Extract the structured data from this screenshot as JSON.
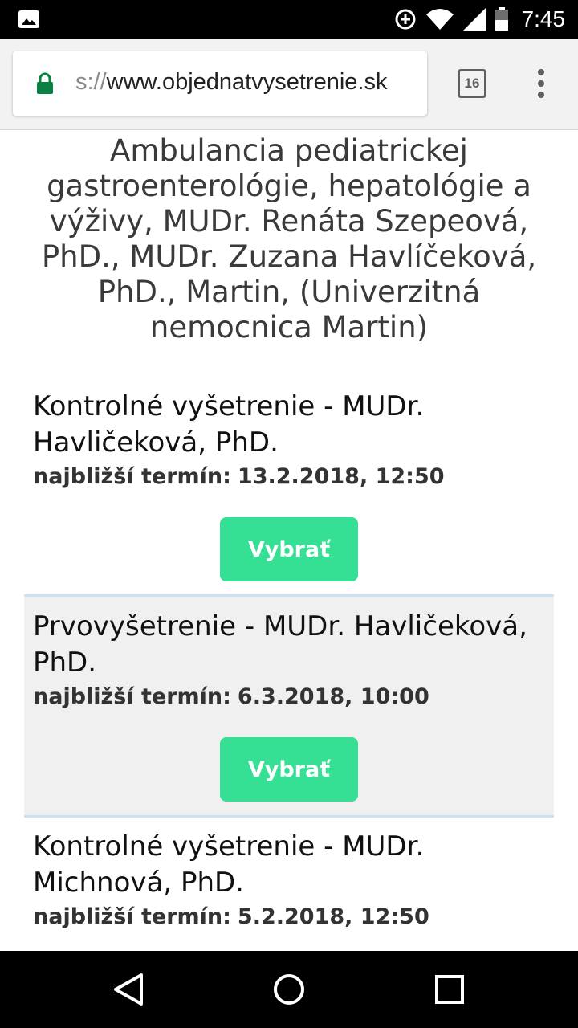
{
  "status_bar": {
    "time": "7:45",
    "icons": [
      "image-notification-icon",
      "data-saver-icon",
      "wifi-icon",
      "cell-signal-icon",
      "battery-icon"
    ]
  },
  "browser": {
    "url_scheme": "s://",
    "url_host": "www.objednatvysetrenie.sk",
    "tab_count": "16",
    "lock_color": "#0b8043"
  },
  "page": {
    "title": "Ambulancia pediatrickej gastroenterológie, hepatológie a výživy, MUDr. Renáta Szepeová, PhD., MUDr. Zuzana Havlíčeková, PhD., Martin, (Univerzitná nemocnica Martin)",
    "next_label": "najbližší termín:",
    "select_label": "Vybrať",
    "accent_color": "#35df93",
    "services": [
      {
        "name": "Kontrolné vyšetrenie - MUDr. Havličeková, PhD.",
        "next_date": "13.2.2018, 12:50"
      },
      {
        "name": "Prvovyšetrenie - MUDr. Havličeková, PhD.",
        "next_date": "6.3.2018, 10:00"
      },
      {
        "name": "Kontrolné vyšetrenie - MUDr. Michnová, PhD.",
        "next_date": "5.2.2018, 12:50"
      }
    ]
  },
  "nav_bar": {
    "buttons": [
      "back-icon",
      "home-icon",
      "recents-icon"
    ]
  }
}
